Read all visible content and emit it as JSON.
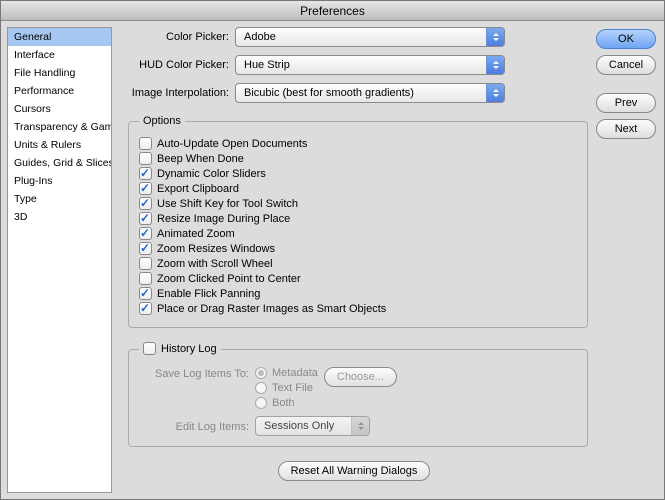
{
  "window_title": "Preferences",
  "sidebar": {
    "items": [
      "General",
      "Interface",
      "File Handling",
      "Performance",
      "Cursors",
      "Transparency & Gamut",
      "Units & Rulers",
      "Guides, Grid & Slices",
      "Plug-Ins",
      "Type",
      "3D"
    ],
    "selected_index": 0
  },
  "pickers": {
    "color_label": "Color Picker:",
    "color_value": "Adobe",
    "hud_label": "HUD Color Picker:",
    "hud_value": "Hue Strip",
    "interp_label": "Image Interpolation:",
    "interp_value": "Bicubic (best for smooth gradients)"
  },
  "options": {
    "legend": "Options",
    "items": [
      {
        "label": "Auto-Update Open Documents",
        "checked": false
      },
      {
        "label": "Beep When Done",
        "checked": false
      },
      {
        "label": "Dynamic Color Sliders",
        "checked": true
      },
      {
        "label": "Export Clipboard",
        "checked": true
      },
      {
        "label": "Use Shift Key for Tool Switch",
        "checked": true
      },
      {
        "label": "Resize Image During Place",
        "checked": true
      },
      {
        "label": "Animated Zoom",
        "checked": true
      },
      {
        "label": "Zoom Resizes Windows",
        "checked": true
      },
      {
        "label": "Zoom with Scroll Wheel",
        "checked": false
      },
      {
        "label": "Zoom Clicked Point to Center",
        "checked": false
      },
      {
        "label": "Enable Flick Panning",
        "checked": true
      },
      {
        "label": "Place or Drag Raster Images as Smart Objects",
        "checked": true
      }
    ]
  },
  "history": {
    "enable_label": "History Log",
    "enable_checked": false,
    "save_label": "Save Log Items To:",
    "radios": [
      {
        "label": "Metadata",
        "selected": true
      },
      {
        "label": "Text File",
        "selected": false
      },
      {
        "label": "Both",
        "selected": false
      }
    ],
    "choose_label": "Choose...",
    "edit_label": "Edit Log Items:",
    "edit_value": "Sessions Only"
  },
  "reset_label": "Reset All Warning Dialogs",
  "buttons": {
    "ok": "OK",
    "cancel": "Cancel",
    "prev": "Prev",
    "next": "Next"
  }
}
